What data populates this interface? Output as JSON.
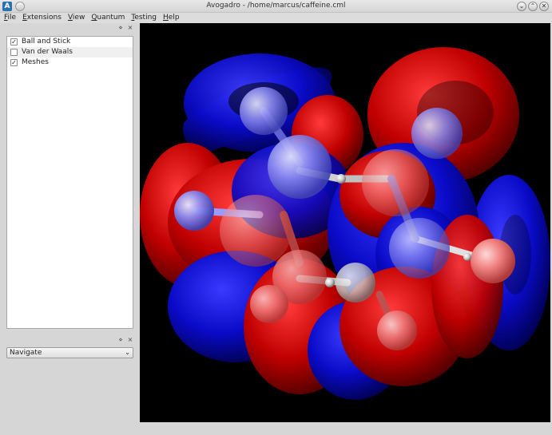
{
  "window": {
    "title": "Avogadro - /home/marcus/caffeine.cml",
    "app_icon": "A",
    "controls": [
      "minimize-icon",
      "maximize-icon",
      "close-icon"
    ]
  },
  "menu": [
    "File",
    "Extensions",
    "View",
    "Quantum",
    "Testing",
    "Help"
  ],
  "engines": [
    {
      "label": "Ball and Stick",
      "checked": true
    },
    {
      "label": "Van der Waals",
      "checked": false
    },
    {
      "label": "Meshes",
      "checked": true
    }
  ],
  "tool": {
    "selected": "Navigate"
  },
  "dock_icons": {
    "float": "⋄",
    "close": "×"
  },
  "colors": {
    "background": "#000000",
    "positive_lobe": "#c00000",
    "negative_lobe": "#0a0ac8"
  }
}
